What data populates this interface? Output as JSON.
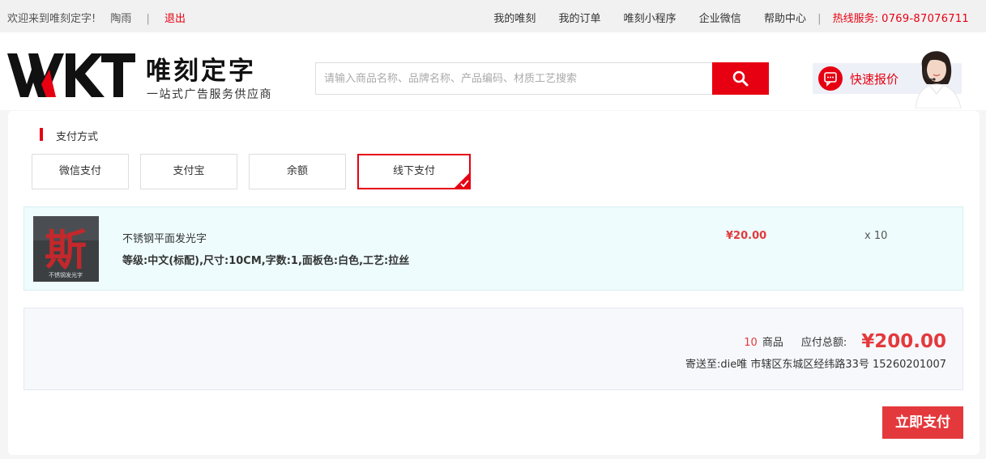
{
  "topbar": {
    "welcome": "欢迎来到唯刻定字!",
    "username": "陶雨",
    "separator": "|",
    "logout": "退出",
    "nav": [
      "我的唯刻",
      "我的订单",
      "唯刻小程序",
      "企业微信",
      "帮助中心"
    ],
    "hotline_label": "热线服务:",
    "hotline_number": "0769-87076711"
  },
  "header": {
    "logo_text": "VVKT",
    "brand_name": "唯刻定字",
    "slogan": "一站式广告服务供应商",
    "search_placeholder": "请输入商品名称、品牌名称、产品编码、材质工艺搜索",
    "search_icon": "search-icon",
    "quote_label": "快速报价",
    "quote_icon": "chat-bubble-icon"
  },
  "payment": {
    "section_title": "支付方式",
    "options": [
      "微信支付",
      "支付宝",
      "余额",
      "线下支付"
    ],
    "selected": "线下支付"
  },
  "order": {
    "thumb_char": "斯",
    "thumb_caption": "不锈钢发光字",
    "name": "不锈钢平面发光字",
    "spec": "等级:中文(标配),尺寸:10CM,字数:1,面板色:白色,工艺:拉丝",
    "price": "¥20.00",
    "qty": "x 10"
  },
  "summary": {
    "count": "10",
    "count_unit": "商品",
    "total_label": "应付总额:",
    "total": "¥200.00",
    "ship_to": "寄送至:die唯 市辖区东城区经纬路33号 15260201007"
  },
  "actions": {
    "pay_now": "立即支付"
  },
  "colors": {
    "accent": "#e60012",
    "price": "#e4393c",
    "order_row_bg": "#eefcfd"
  }
}
